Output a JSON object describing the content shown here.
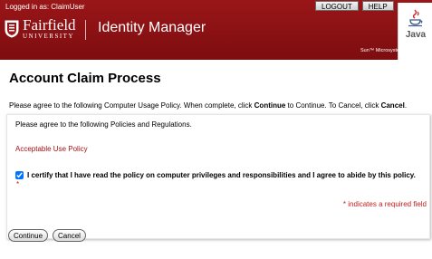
{
  "header": {
    "logged_in": "Logged in as: ClaimUser",
    "logout_label": "LOGOUT",
    "help_label": "HELP",
    "university_name": "Fairfield",
    "university_sub": "UNIVERSITY",
    "app_name": "Identity Manager",
    "java_label": "Java",
    "sun_credit": "Sun™ Microsystems, Inc."
  },
  "page": {
    "title": "Account Claim Process",
    "instructions_pre": "Please agree to the following Computer Usage Policy. When complete, click ",
    "continue_word": "Continue",
    "instructions_mid": " to Continue. To Cancel, click ",
    "cancel_word": "Cancel",
    "instructions_end": "."
  },
  "form": {
    "agree_text": "Please agree to the following Policies and Regulations.",
    "policy_link": "Acceptable Use Policy",
    "certify_label": "I certify that I have read the policy on computer privileges and responsibilities and I agree to abide by this policy.",
    "certify_checked": true,
    "required_star": "*",
    "required_note": "indicates a required field"
  },
  "buttons": {
    "continue_label": "Continue",
    "cancel_label": "Cancel"
  },
  "colors": {
    "header_red": "#8c1214",
    "link_red": "#a31216",
    "required_red": "#c41e1e"
  }
}
